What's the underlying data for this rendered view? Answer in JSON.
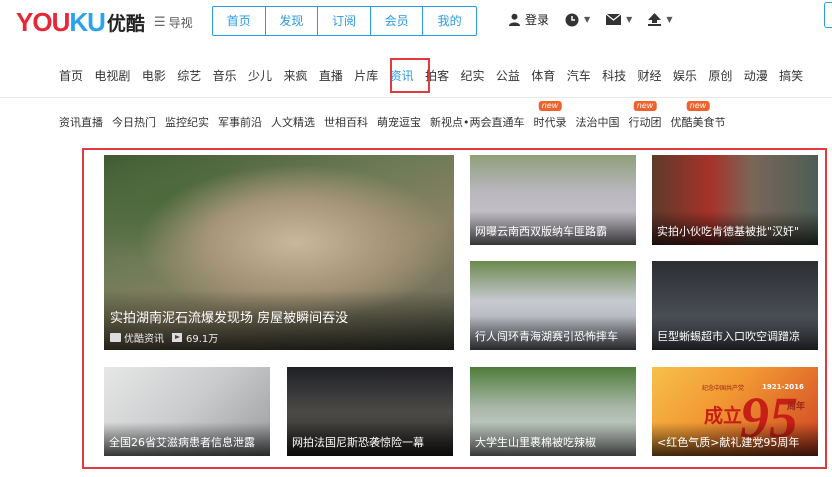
{
  "logo": {
    "en_you": "YOU",
    "en_ku": "KU",
    "cn": "优酷"
  },
  "guide": {
    "icon": "menu-icon",
    "label": "导视"
  },
  "top_tabs": [
    "首页",
    "发现",
    "订阅",
    "会员",
    "我的"
  ],
  "user": {
    "login_label": "登录"
  },
  "channels": [
    "首页",
    "电视剧",
    "电影",
    "综艺",
    "音乐",
    "少儿",
    "来疯",
    "直播",
    "片库",
    "资讯",
    "拍客",
    "纪实",
    "公益",
    "体育",
    "汽车",
    "科技",
    "财经",
    "娱乐",
    "原创",
    "动漫",
    "搞笑"
  ],
  "active_channel": "资讯",
  "sub_nav": [
    {
      "label": "资讯直播",
      "badge": ""
    },
    {
      "label": "今日热门",
      "badge": ""
    },
    {
      "label": "监控纪实",
      "badge": ""
    },
    {
      "label": "军事前沿",
      "badge": ""
    },
    {
      "label": "人文精选",
      "badge": ""
    },
    {
      "label": "世相百科",
      "badge": ""
    },
    {
      "label": "萌宠逗宝",
      "badge": ""
    },
    {
      "label": "新视点•两会直通车",
      "badge": ""
    },
    {
      "label": "时代录",
      "badge": "new"
    },
    {
      "label": "法治中国",
      "badge": ""
    },
    {
      "label": "行动团",
      "badge": "new"
    },
    {
      "label": "优酷美食节",
      "badge": "new"
    }
  ],
  "featured": {
    "title": "实拍湖南泥石流爆发现场 房屋被瞬间吞没",
    "source": "优酷资讯",
    "plays": "69.1万"
  },
  "cards": [
    {
      "title": "网曝云南西双版纳车匪路霸"
    },
    {
      "title": "实拍小伙吃肯德基被批\"汉奸\""
    },
    {
      "title": "行人闯环青海湖赛引恐怖摔车"
    },
    {
      "title": "巨型蜥蜴超市入口吹空调蹭凉"
    },
    {
      "title": "全国26省艾滋病患者信息泄露"
    },
    {
      "title": "网拍法国尼斯恐袭惊险一幕"
    },
    {
      "title": "大学生山里裹棉被吃辣椒"
    },
    {
      "title": "<红色气质>献礼建党95周年"
    }
  ],
  "party_banner": {
    "top": "纪念中国共产党",
    "chengli": "成立",
    "num": "95",
    "years": "1921-2016",
    "zhounian": "周年"
  }
}
